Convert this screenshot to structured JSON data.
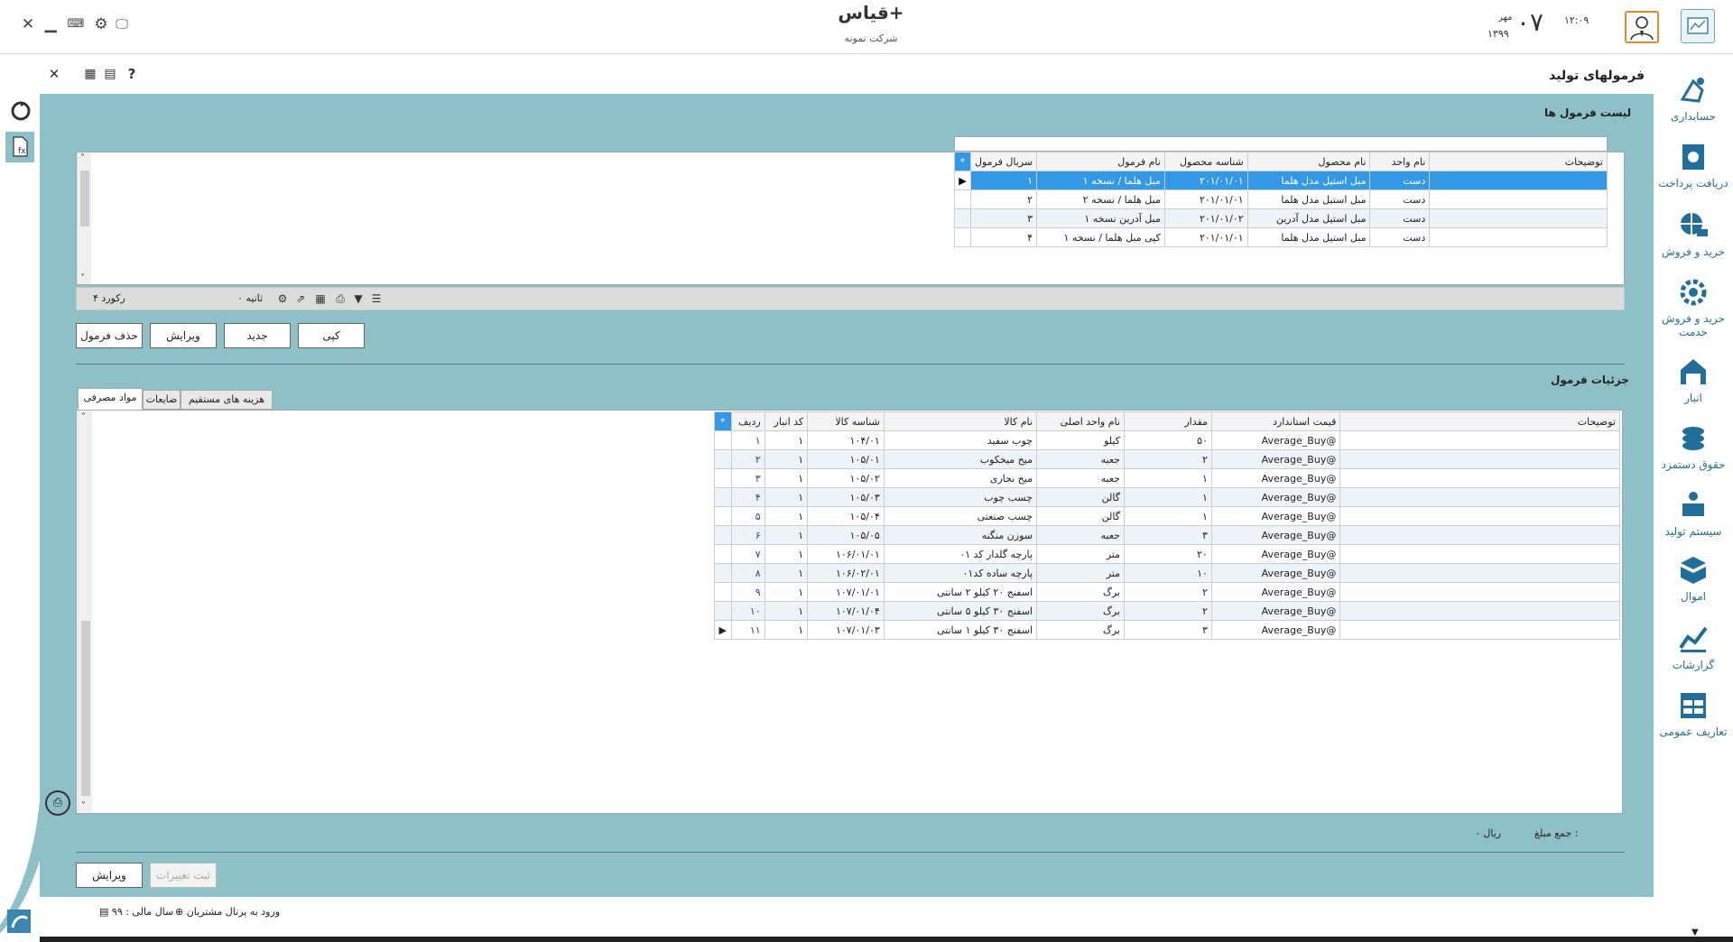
{
  "header": {
    "app_title": "قیاس+",
    "company": "شرکت نمونه",
    "time": "۱۲:۰۹",
    "day": "۰۷",
    "month": "مهر",
    "year": "۱۳۹۹"
  },
  "subbar": {
    "page_title": "فرمولهای تولید"
  },
  "sidebar": {
    "items": [
      {
        "label": "حسابداری",
        "icon": "accounting-icon"
      },
      {
        "label": "دریافت پرداخت",
        "icon": "payment-icon"
      },
      {
        "label": "خرید و فروش",
        "icon": "globe-cart-icon"
      },
      {
        "label": "خرید و فروش خدمت",
        "icon": "service-gear-icon"
      },
      {
        "label": "انبار",
        "icon": "warehouse-icon"
      },
      {
        "label": "حقوق دستمزد",
        "icon": "coins-icon"
      },
      {
        "label": "سیستم تولید",
        "icon": "production-icon"
      },
      {
        "label": "اموال",
        "icon": "box-icon"
      },
      {
        "label": "گزارشات",
        "icon": "chart-icon"
      },
      {
        "label": "تعاریف عمومی",
        "icon": "table-icon"
      }
    ]
  },
  "formula_list": {
    "title": "لیست فرمول ها",
    "columns": [
      "سریال فرمول",
      "نام فرمول",
      "شناسه محصول",
      "نام محصول",
      "نام واحد",
      "توضیحات"
    ],
    "rows": [
      [
        "۱",
        "مبل هلما / نسخه ۱",
        "۲۰۱/۰۱/۰۱",
        "مبل استیل مدل هلما",
        "دست",
        ""
      ],
      [
        "۲",
        "مبل هلما / نسخه ۲",
        "۲۰۱/۰۱/۰۱",
        "مبل استیل مدل هلما",
        "دست",
        ""
      ],
      [
        "۳",
        "مبل آدرین نسخه ۱",
        "۲۰۱/۰۱/۰۲",
        "مبل استیل مدل آدرین",
        "دست",
        ""
      ],
      [
        "۴",
        "کپی مبل هلما / نسخه ۱",
        "۲۰۱/۰۱/۰۱",
        "مبل استیل مدل هلما",
        "دست",
        ""
      ]
    ],
    "record_count": "۴ رکورد",
    "seconds": "۰ ثانیه"
  },
  "list_buttons": {
    "copy": "کپی",
    "new": "جدید",
    "edit": "ویرایش",
    "delete": "حذف فرمول"
  },
  "details": {
    "title": "جزئیات فرمول",
    "tabs": [
      "مواد مصرفی",
      "ضایعات",
      "هزینه های مستقیم"
    ],
    "columns": [
      "ردیف",
      "کد انبار",
      "شناسه کالا",
      "نام کالا",
      "نام واحد اصلی",
      "مقدار",
      "قیمت استاندارد",
      "توضیحات"
    ],
    "rows": [
      [
        "۱",
        "۱",
        "۱۰۴/۰۱",
        "چوب سفید",
        "کیلو",
        "۵۰",
        "Average_Buy@",
        ""
      ],
      [
        "۲",
        "۱",
        "۱۰۵/۰۱",
        "میخ میخکوب",
        "جعبه",
        "۲",
        "Average_Buy@",
        ""
      ],
      [
        "۳",
        "۱",
        "۱۰۵/۰۲",
        "میخ نجاری",
        "جعبه",
        "۱",
        "Average_Buy@",
        ""
      ],
      [
        "۴",
        "۱",
        "۱۰۵/۰۳",
        "چسب چوب",
        "گالن",
        "۱",
        "Average_Buy@",
        ""
      ],
      [
        "۵",
        "۱",
        "۱۰۵/۰۴",
        "چسب صنعتی",
        "گالن",
        "۱",
        "Average_Buy@",
        ""
      ],
      [
        "۶",
        "۱",
        "۱۰۵/۰۵",
        "سوزن منگنه",
        "جعبه",
        "۳",
        "Average_Buy@",
        ""
      ],
      [
        "۷",
        "۱",
        "۱۰۶/۰۱/۰۱",
        "پارچه گلدار کد ۰۱",
        "متر",
        "۲۰",
        "Average_Buy@",
        ""
      ],
      [
        "۸",
        "۱",
        "۱۰۶/۰۲/۰۱",
        "پارچه ساده کد۰۱",
        "متر",
        "۱۰",
        "Average_Buy@",
        ""
      ],
      [
        "۹",
        "۱",
        "۱۰۷/۰۱/۰۱",
        "اسفنج ۲۰ کیلو ۲ سانتی",
        "برگ",
        "۲",
        "Average_Buy@",
        ""
      ],
      [
        "۱۰",
        "۱",
        "۱۰۷/۰۱/۰۴",
        "اسفنج ۳۰ کیلو ۵ سانتی",
        "برگ",
        "۲",
        "Average_Buy@",
        ""
      ],
      [
        "۱۱",
        "۱",
        "۱۰۷/۰۱/۰۳",
        "اسفنج ۳۰ کیلو ۱ سانتی",
        "برگ",
        "۳",
        "Average_Buy@",
        ""
      ]
    ],
    "total_label": "جمع مبلغ :",
    "total_value": "۰ ریال"
  },
  "footer_buttons": {
    "save": "ثبت تغییرات",
    "edit": "ویرایش"
  },
  "statusbar": {
    "portal": "ورود به پرتال مشتریان",
    "fiscal_year": "سال مالی : ۹۹"
  },
  "colors": {
    "panel": "#8dc1c7",
    "selection": "#3399e6",
    "nav_text": "#1f6f9a",
    "avatar_border": "#e08a2e"
  }
}
